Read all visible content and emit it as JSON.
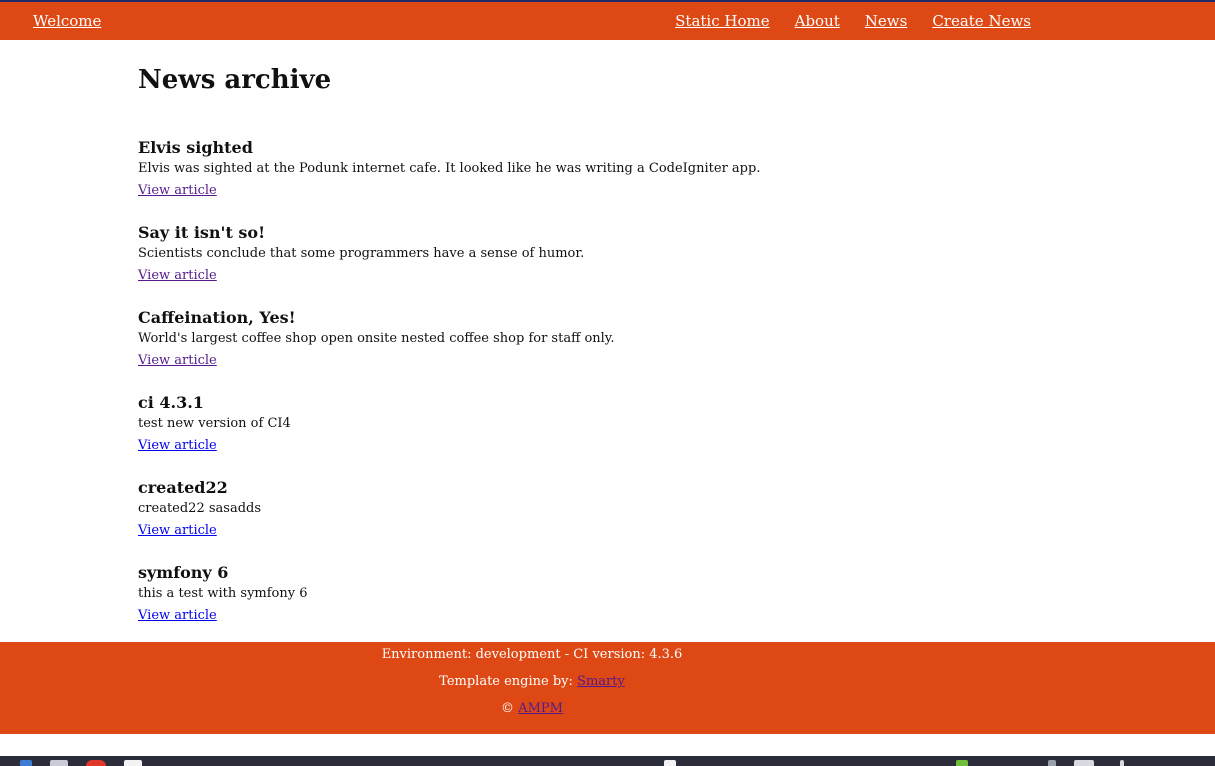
{
  "nav": {
    "welcome": "Welcome",
    "links": [
      "Static Home",
      "About",
      "News",
      "Create News"
    ]
  },
  "page": {
    "title": "News archive"
  },
  "news": [
    {
      "title": "Elvis sighted",
      "body": "Elvis was sighted at the Podunk internet cafe. It looked like he was writing a CodeIgniter app.",
      "link": "View article",
      "visited": true
    },
    {
      "title": "Say it isn't so!",
      "body": "Scientists conclude that some programmers have a sense of humor.",
      "link": "View article",
      "visited": true
    },
    {
      "title": "Caffeination, Yes!",
      "body": "World's largest coffee shop open onsite nested coffee shop for staff only.",
      "link": "View article",
      "visited": true
    },
    {
      "title": "ci 4.3.1",
      "body": "test new version of CI4",
      "link": "View article",
      "visited": false
    },
    {
      "title": "created22",
      "body": "created22 sasadds",
      "link": "View article",
      "visited": false
    },
    {
      "title": "symfony 6",
      "body": "this a test with symfony 6",
      "link": "View article",
      "visited": false
    }
  ],
  "footer": {
    "environment": "Environment: development - CI version: 4.3.6",
    "engine_prefix": "Template engine by: ",
    "engine_link": "Smarty",
    "copyright_symbol": "©",
    "copyright_link": "AMPM"
  },
  "colors": {
    "brand": "#dd4814",
    "link": "#0000ee",
    "visited_link": "#551a8b"
  }
}
